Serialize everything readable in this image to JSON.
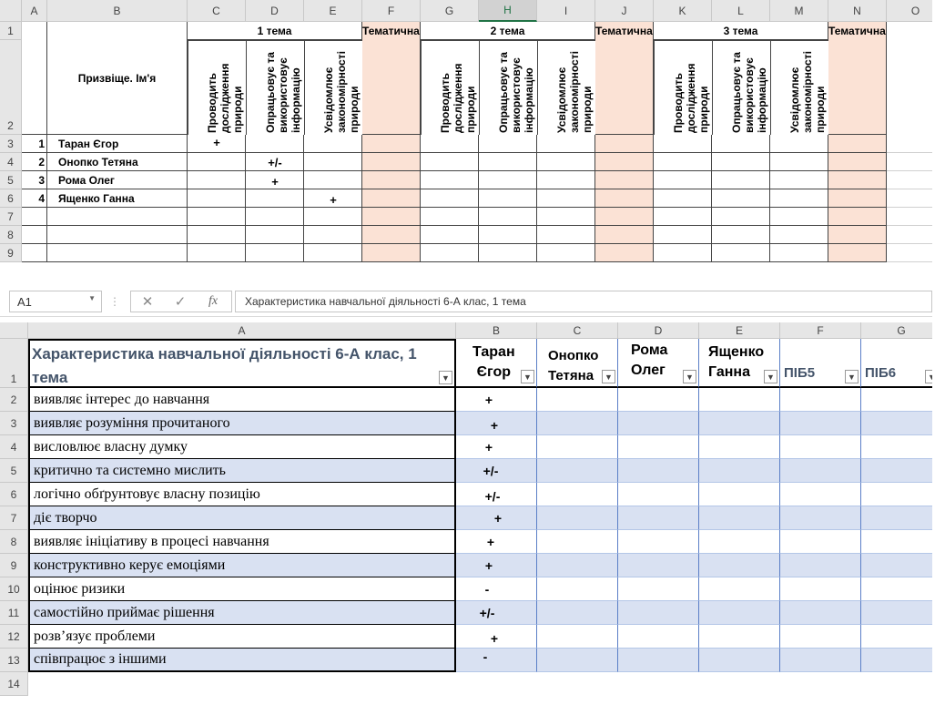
{
  "top": {
    "columns": [
      "A",
      "B",
      "C",
      "D",
      "E",
      "F",
      "G",
      "H",
      "I",
      "J",
      "K",
      "L",
      "M",
      "N",
      "O"
    ],
    "rows": [
      "1",
      "2",
      "3",
      "4",
      "5",
      "6",
      "7",
      "8",
      "9"
    ],
    "name_header": "Призвіще. Ім'я",
    "topics": [
      "1 тема",
      "2 тема",
      "3 тема"
    ],
    "thematic": "Тематична",
    "sub_headers": [
      "Проводить дослідження природи",
      "Опрацьовує та використовує інформацію",
      "Усвідомлює закономірності природи"
    ],
    "students": [
      {
        "num": "1",
        "name": "Таран Єгор",
        "c": "+",
        "d": "",
        "e": ""
      },
      {
        "num": "2",
        "name": "Онопко Тетяна",
        "c": "",
        "d": "+/-",
        "e": ""
      },
      {
        "num": "3",
        "name": "Рома Олег",
        "c": "",
        "d": "+",
        "e": ""
      },
      {
        "num": "4",
        "name": "Ященко Ганна",
        "c": "",
        "d": "",
        "e": "+"
      }
    ]
  },
  "bottom": {
    "name_box": "A1",
    "formula_icons": [
      "cancel-icon",
      "confirm-icon",
      "function-icon"
    ],
    "cancel_glyph": "✕",
    "confirm_glyph": "✓",
    "fx_glyph": "fx",
    "formula": "Характеристика навчальної діяльності  6-А клас, 1 тема",
    "columns": [
      "A",
      "B",
      "C",
      "D",
      "E",
      "F",
      "G"
    ],
    "header_a_line1": "Характеристика навчальної діяльності  6-А клас, 1",
    "header_a_line2": "тема",
    "header_b": [
      "Таран",
      "Єгор"
    ],
    "header_c": [
      "Онопко",
      "Тетяна"
    ],
    "header_d": [
      "Рома",
      "Олег"
    ],
    "header_e": [
      "Ященко",
      "Ганна"
    ],
    "header_f": "ПІБ5",
    "header_g": "ПІБ6",
    "row_numbers": [
      "1",
      "2",
      "3",
      "4",
      "5",
      "6",
      "7",
      "8",
      "9",
      "10",
      "11",
      "12",
      "13",
      "14"
    ],
    "items": [
      {
        "text": "виявляє інтерес до навчання",
        "mark": "+"
      },
      {
        "text": "виявляє розуміння прочитаного",
        "mark": "+"
      },
      {
        "text": "висловлює власну думку",
        "mark": "+"
      },
      {
        "text": "критично та системно мислить",
        "mark": "+/-"
      },
      {
        "text": "логічно обґрунтовує власну позицію",
        "mark": "+/-"
      },
      {
        "text": "діє творчо",
        "mark": "+"
      },
      {
        "text": "виявляє ініціативу в процесі навчання",
        "mark": "+"
      },
      {
        "text": "конструктивно керує емоціями",
        "mark": "+"
      },
      {
        "text": "оцінює ризики",
        "mark": "-"
      },
      {
        "text": "самостійно приймає рішення",
        "mark": "+/-"
      },
      {
        "text": "розв’язує проблеми",
        "mark": "+"
      },
      {
        "text": "співпрацює з іншими",
        "mark": "-"
      }
    ],
    "colors": {
      "band": "#d9e1f2",
      "header_text": "#44546a",
      "salmon": "#fbe2d5"
    }
  }
}
